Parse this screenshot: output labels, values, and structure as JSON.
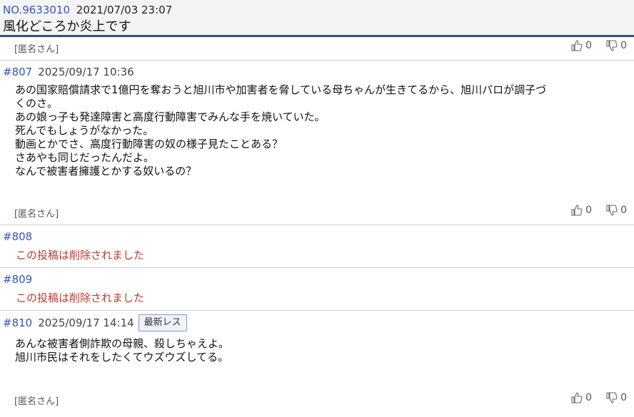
{
  "header": {
    "thread_no": "NO.9633010",
    "date": "2021/07/03 23:07",
    "title": "風化どころか炎上です",
    "author": "[匿名さん]",
    "likes": "0",
    "dislikes": "0"
  },
  "posts": [
    {
      "num": "#807",
      "date": "2025/09/17 10:36",
      "lines": [
        "あの国家賠償請求で1億円を奪おうと旭川市や加害者を脅している母ちゃんが生きてるから、旭川パロが調子づ",
        "くのさ。",
        "あの娘っ子も発達障害と高度行動障害でみんな手を焼いていた。",
        "死んでもしょうがなかった。",
        "動画とかでさ、高度行動障害の奴の様子見たことある？",
        "さあやも同じだったんだよ。",
        "なんで被害者擁護とかする奴いるの？"
      ],
      "author": "[匿名さん]",
      "likes": "0",
      "dislikes": "0"
    },
    {
      "num": "#808",
      "deleted_text": "この投稿は削除されました"
    },
    {
      "num": "#809",
      "deleted_text": "この投稿は削除されました"
    },
    {
      "num": "#810",
      "date": "2025/09/17 14:14",
      "badge": "最新レス",
      "lines": [
        "あんな被害者側詐欺の母親、殺しちゃえよ。",
        "旭川市民はそれをしたくてウズウズしてる。"
      ],
      "author": "[匿名さん]",
      "likes": "0",
      "dislikes": "0"
    }
  ],
  "icons": {
    "like": "thumbs-up-icon",
    "dislike": "thumbs-down-icon"
  },
  "colors": {
    "link": "#3355bb",
    "deleted": "#c0392b",
    "header_rule": "#3c4f74"
  }
}
